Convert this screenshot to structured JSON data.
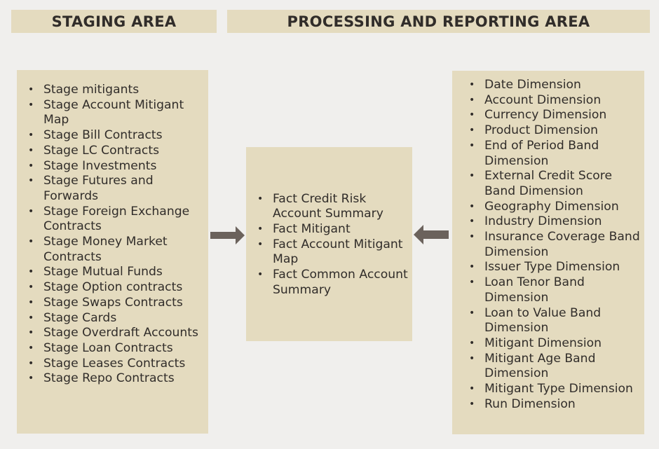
{
  "headers": {
    "staging": "STAGING AREA",
    "processing": "PROCESSING AND REPORTING AREA"
  },
  "colors": {
    "background": "#f0efed",
    "box_fill": "#e4dbbf",
    "text": "#312d2a",
    "arrow": "#6b625c"
  },
  "staging_items": [
    "Stage mitigants",
    "Stage Account Mitigant Map",
    "Stage Bill Contracts",
    "Stage LC Contracts",
    "Stage Investments",
    "Stage Futures and Forwards",
    "Stage Foreign Exchange Contracts",
    "Stage Money Market Contracts",
    "Stage Mutual Funds",
    "Stage Option contracts",
    "Stage Swaps Contracts",
    "Stage Cards",
    "Stage Overdraft Accounts",
    "Stage Loan Contracts",
    "Stage Leases Contracts",
    "Stage Repo Contracts"
  ],
  "fact_items": [
    "Fact Credit Risk Account Summary",
    "Fact Mitigant",
    "Fact Account Mitigant Map",
    "Fact Common Account Summary"
  ],
  "dimension_items": [
    "Date Dimension",
    "Account Dimension",
    "Currency Dimension",
    "Product Dimension",
    "End of Period Band Dimension",
    "External Credit Score Band Dimension",
    "Geography Dimension",
    "Industry Dimension",
    "Insurance Coverage Band Dimension",
    "Issuer Type Dimension",
    "Loan Tenor Band Dimension",
    "Loan to Value Band Dimension",
    "Mitigant Dimension",
    "Mitigant Age Band Dimension",
    "Mitigant Type Dimension",
    "Run Dimension"
  ],
  "arrows": {
    "staging_to_fact": "arrow-right",
    "dimensions_to_fact": "arrow-left"
  }
}
